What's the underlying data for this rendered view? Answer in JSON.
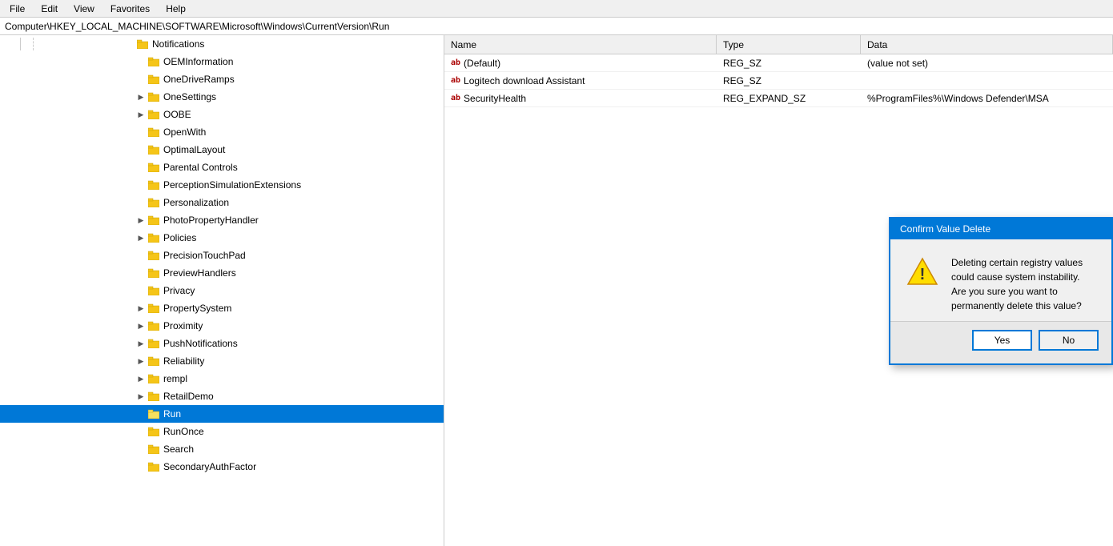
{
  "menu": {
    "items": [
      "File",
      "Edit",
      "View",
      "Favorites",
      "Help"
    ]
  },
  "address": {
    "path": "Computer\\HKEY_LOCAL_MACHINE\\SOFTWARE\\Microsoft\\Windows\\CurrentVersion\\Run"
  },
  "tree": {
    "items": [
      {
        "label": "Notifications",
        "indent": 1,
        "hasExpand": false,
        "hasChildren": false
      },
      {
        "label": "OEMInformation",
        "indent": 1,
        "hasExpand": false,
        "hasChildren": false
      },
      {
        "label": "OneDriveRamps",
        "indent": 1,
        "hasExpand": false,
        "hasChildren": false
      },
      {
        "label": "OneSettings",
        "indent": 1,
        "hasExpand": true,
        "hasChildren": true
      },
      {
        "label": "OOBE",
        "indent": 1,
        "hasExpand": true,
        "hasChildren": true
      },
      {
        "label": "OpenWith",
        "indent": 1,
        "hasExpand": false,
        "hasChildren": false
      },
      {
        "label": "OptimalLayout",
        "indent": 1,
        "hasExpand": false,
        "hasChildren": false
      },
      {
        "label": "Parental Controls",
        "indent": 1,
        "hasExpand": false,
        "hasChildren": false
      },
      {
        "label": "PerceptionSimulationExtensions",
        "indent": 1,
        "hasExpand": false,
        "hasChildren": false
      },
      {
        "label": "Personalization",
        "indent": 1,
        "hasExpand": false,
        "hasChildren": false
      },
      {
        "label": "PhotoPropertyHandler",
        "indent": 1,
        "hasExpand": true,
        "hasChildren": true
      },
      {
        "label": "Policies",
        "indent": 1,
        "hasExpand": true,
        "hasChildren": true
      },
      {
        "label": "PrecisionTouchPad",
        "indent": 1,
        "hasExpand": false,
        "hasChildren": false
      },
      {
        "label": "PreviewHandlers",
        "indent": 1,
        "hasExpand": false,
        "hasChildren": false
      },
      {
        "label": "Privacy",
        "indent": 1,
        "hasExpand": false,
        "hasChildren": false
      },
      {
        "label": "PropertySystem",
        "indent": 1,
        "hasExpand": true,
        "hasChildren": true
      },
      {
        "label": "Proximity",
        "indent": 1,
        "hasExpand": true,
        "hasChildren": true
      },
      {
        "label": "PushNotifications",
        "indent": 1,
        "hasExpand": true,
        "hasChildren": true
      },
      {
        "label": "Reliability",
        "indent": 1,
        "hasExpand": true,
        "hasChildren": true
      },
      {
        "label": "rempl",
        "indent": 1,
        "hasExpand": true,
        "hasChildren": true
      },
      {
        "label": "RetailDemo",
        "indent": 1,
        "hasExpand": true,
        "hasChildren": true
      },
      {
        "label": "Run",
        "indent": 1,
        "hasExpand": false,
        "hasChildren": false,
        "selected": true
      },
      {
        "label": "RunOnce",
        "indent": 1,
        "hasExpand": false,
        "hasChildren": false
      },
      {
        "label": "Search",
        "indent": 1,
        "hasExpand": false,
        "hasChildren": false
      },
      {
        "label": "SecondaryAuthFactor",
        "indent": 1,
        "hasExpand": false,
        "hasChildren": false
      }
    ]
  },
  "registry": {
    "headers": [
      "Name",
      "Type",
      "Data"
    ],
    "rows": [
      {
        "name": "(Default)",
        "type": "REG_SZ",
        "data": "(value not set)",
        "icon": "ab"
      },
      {
        "name": "Logitech download Assistant",
        "type": "REG_SZ",
        "data": "",
        "icon": "ab"
      },
      {
        "name": "SecurityHealth",
        "type": "REG_EXPAND_SZ",
        "data": "%ProgramFiles%\\Windows Defender\\MSA",
        "icon": "ab"
      }
    ]
  },
  "dialog": {
    "title": "Confirm Value Delete",
    "message": "Deleting certain registry values could cause system instability. Are you sure you want to permanently delete this value?",
    "yes_label": "Yes",
    "no_label": "No"
  },
  "colors": {
    "accent": "#0078d7",
    "warning_bg": "#ffff00",
    "selected": "#0078d7"
  }
}
